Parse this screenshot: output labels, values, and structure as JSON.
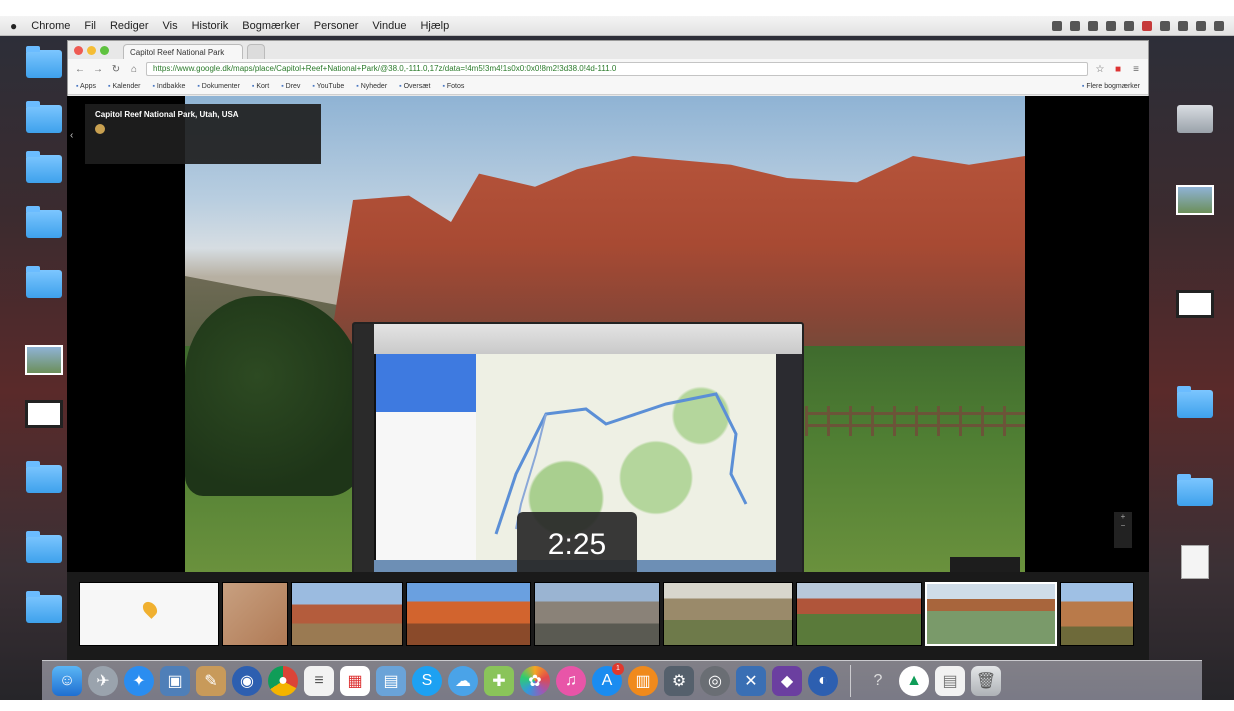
{
  "menubar": {
    "apple": "",
    "items": [
      "Chrome",
      "Fil",
      "Rediger",
      "Vis",
      "Historik",
      "Bogmærker",
      "Personer",
      "Vindue",
      "Hjælp"
    ]
  },
  "browser": {
    "tab_title": "Capitol Reef National Park",
    "url": "https://www.google.dk/maps/place/Capitol+Reef+National+Park/@38.0,-111.0,17z/data=!4m5!3m4!1s0x0:0x0!8m2!3d38.0!4d-111.0",
    "bookmarks": [
      "Apps",
      "Kalender",
      "Indbakke",
      "Dokumenter",
      "Kort",
      "Drev",
      "YouTube",
      "Nyheder",
      "Oversæt",
      "Fotos",
      "Flere bogmærker"
    ]
  },
  "infobox": {
    "title": "Capitol Reef National Park, Utah, USA",
    "author": "",
    "meta": ""
  },
  "video": {
    "timestamp": "2:25"
  },
  "filmstrip": {
    "frames": [
      "",
      "",
      "",
      "",
      "",
      "",
      "",
      "",
      "",
      "",
      ""
    ]
  },
  "colors": {
    "accent": "#3e7ae0",
    "badge": "#e0392e"
  },
  "dock": {
    "icons": [
      "finder-icon",
      "launchpad-icon",
      "safari-icon",
      "preview-icon",
      "notes-icon",
      "google-earth-icon",
      "chrome-icon",
      "textedit-icon",
      "calendar-icon",
      "photos-browser-icon",
      "skype-icon",
      "messages-icon",
      "maps-icon",
      "photos-icon",
      "itunes-icon",
      "app-store-icon",
      "books-icon",
      "system-preferences-icon",
      "network-icon",
      "xcode-icon",
      "visual-studio-icon",
      "google-earth-pro-icon",
      "help-icon",
      "drive-icon",
      "documents-icon",
      "trash-icon"
    ],
    "app_store_badge": "1"
  }
}
